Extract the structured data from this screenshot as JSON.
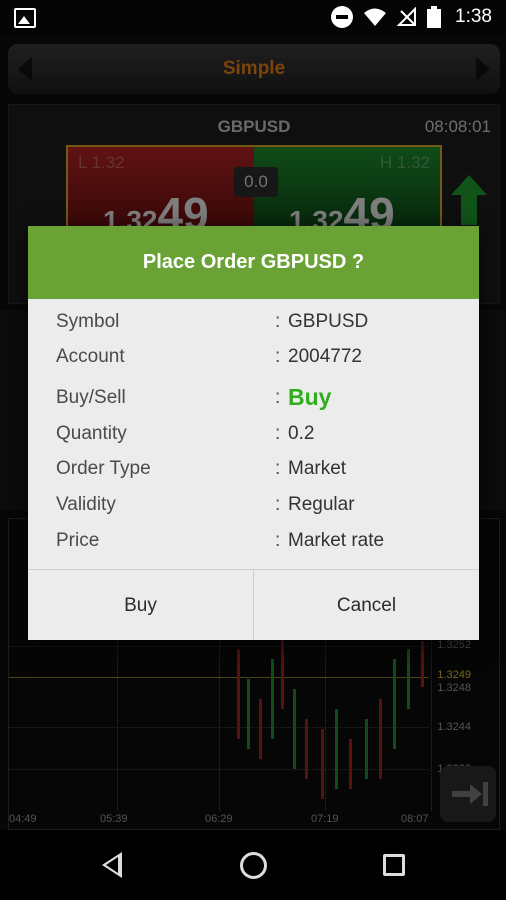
{
  "status_bar": {
    "time": "1:38"
  },
  "app": {
    "mode_title": "Simple",
    "quote": {
      "symbol": "GBPUSD",
      "time": "08:08:01",
      "spread": "0.0",
      "sell_label": "L 1.32",
      "buy_label": "H 1.32",
      "sell_price_prefix": "1.32",
      "sell_price_big": "49",
      "buy_price_prefix": "1.32",
      "buy_price_big": "49"
    },
    "chart": {
      "x_ticks": [
        "04:49",
        "05:39",
        "06:29",
        "07:19",
        "08:07"
      ],
      "y_ticks": [
        "1.3252",
        "1.3249",
        "1.3248",
        "1.3244",
        "1.3239"
      ]
    }
  },
  "dialog": {
    "title": "Place Order GBPUSD ?",
    "separator": ":",
    "fields": [
      {
        "label": "Symbol",
        "value": "GBPUSD"
      },
      {
        "label": "Account",
        "value": "2004772"
      },
      {
        "label": "Buy/Sell",
        "value": "Buy"
      },
      {
        "label": "Quantity",
        "value": "0.2"
      },
      {
        "label": "Order Type",
        "value": "Market"
      },
      {
        "label": "Validity",
        "value": "Regular"
      },
      {
        "label": "Price",
        "value": "Market rate"
      }
    ],
    "confirm_label": "Buy",
    "cancel_label": "Cancel"
  },
  "colors": {
    "header_green": "#6aa235",
    "buy_green": "#2fae1e",
    "mode_orange": "#e07a18"
  }
}
